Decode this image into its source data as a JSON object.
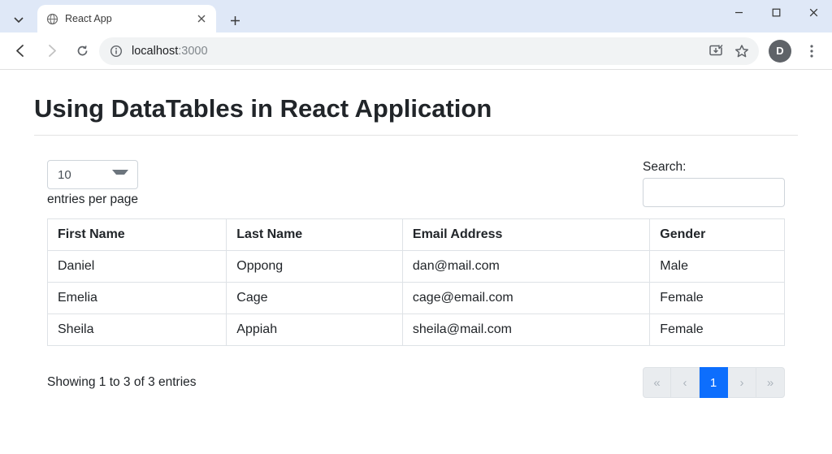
{
  "browser": {
    "tab_title": "React App",
    "url_host": "localhost",
    "url_port_path": ":3000",
    "avatar_initial": "D"
  },
  "page": {
    "title": "Using DataTables in React Application"
  },
  "datatable": {
    "length_value": "10",
    "length_label": "entries per page",
    "search_label": "Search:",
    "search_value": "",
    "columns": [
      "First Name",
      "Last Name",
      "Email Address",
      "Gender"
    ],
    "rows": [
      {
        "first": "Daniel",
        "last": "Oppong",
        "email": "dan@mail.com",
        "gender": "Male"
      },
      {
        "first": "Emelia",
        "last": "Cage",
        "email": "cage@email.com",
        "gender": "Female"
      },
      {
        "first": "Sheila",
        "last": "Appiah",
        "email": "sheila@mail.com",
        "gender": "Female"
      }
    ],
    "info_text": "Showing 1 to 3 of 3 entries",
    "pager": {
      "first": "«",
      "prev": "‹",
      "pages": [
        "1"
      ],
      "active_page": "1",
      "next": "›",
      "last": "»"
    }
  }
}
